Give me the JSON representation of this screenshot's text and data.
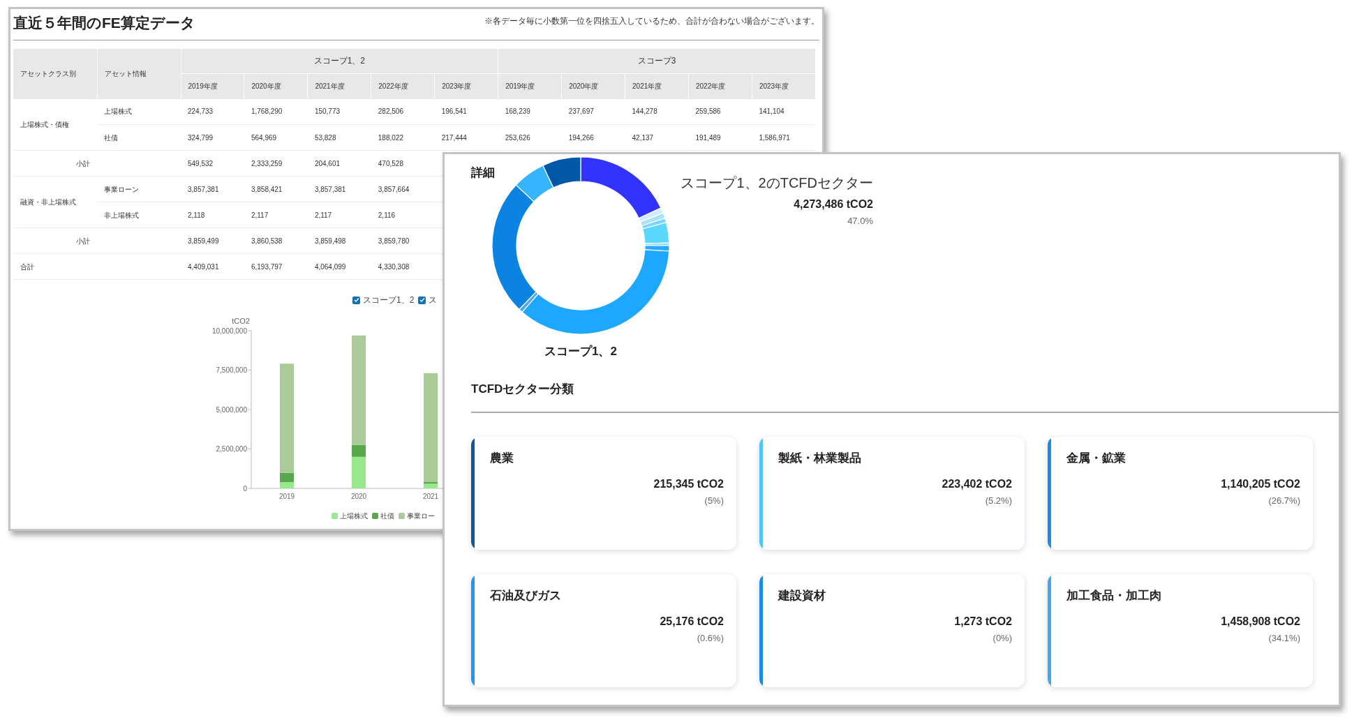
{
  "back_window": {
    "title": "直近５年間のFE算定データ",
    "note": "※各データ毎に小数第一位を四捨五入しているため、合計が合わない場合がございます。",
    "table": {
      "columns": [
        "アセットクラス別",
        "アセット情報"
      ],
      "groups": [
        {
          "label": "スコープ1、2"
        },
        {
          "label": "スコープ3"
        }
      ],
      "years": [
        "2019年度",
        "2020年度",
        "2021年度",
        "2022年度",
        "2023年度",
        "2019年度",
        "2020年度",
        "2021年度",
        "2022年度",
        "2023年度"
      ],
      "sections": [
        {
          "asset_class": "上場株式・債権",
          "rows": [
            {
              "asset": "上場株式",
              "values": [
                "224,733",
                "1,768,290",
                "150,773",
                "282,506",
                "196,541",
                "168,239",
                "237,697",
                "144,278",
                "259,586",
                "141,104"
              ]
            },
            {
              "asset": "社債",
              "values": [
                "324,799",
                "564,969",
                "53,828",
                "188,022",
                "217,444",
                "253,626",
                "194,266",
                "42,137",
                "191,489",
                "1,586,971"
              ]
            }
          ],
          "subtotal": {
            "label": "小計",
            "values": [
              "549,532",
              "2,333,259",
              "204,601",
              "470,528"
            ]
          }
        },
        {
          "asset_class": "融資・非上場株式",
          "rows": [
            {
              "asset": "事業ローン",
              "values": [
                "3,857,381",
                "3,858,421",
                "3,857,381",
                "3,857,664"
              ]
            },
            {
              "asset": "非上場株式",
              "values": [
                "2,118",
                "2,117",
                "2,117",
                "2,116"
              ]
            }
          ],
          "subtotal": {
            "label": "小計",
            "values": [
              "3,859,499",
              "3,860,538",
              "3,859,498",
              "3,859,780"
            ]
          }
        }
      ],
      "total": {
        "label": "合計",
        "values": [
          "4,409,031",
          "6,193,797",
          "4,064,099",
          "4,330,308"
        ]
      }
    },
    "scope_toggles": [
      {
        "label": "スコープ1、2",
        "checked": true
      },
      {
        "label": "ス",
        "checked": true
      }
    ],
    "chart_data": {
      "type": "bar",
      "ylabel": "tCO2",
      "categories": [
        "2019",
        "2020",
        "2021"
      ],
      "stacked": true,
      "ylim": [
        0,
        10000000
      ],
      "yticks": [
        {
          "value": 0,
          "label": "0"
        },
        {
          "value": 2500000,
          "label": "2,500,000"
        },
        {
          "value": 5000000,
          "label": "5,000,000"
        },
        {
          "value": 7500000,
          "label": "7,500,000"
        },
        {
          "value": 10000000,
          "label": "10,000,000"
        }
      ],
      "series": [
        {
          "name": "上場株式",
          "color": "#98e88e",
          "values": [
            400000,
            2000000,
            300000
          ]
        },
        {
          "name": "社債",
          "color": "#57a84a",
          "values": [
            580000,
            760000,
            100000
          ]
        },
        {
          "name": "事業ロー",
          "color": "#a8cb98",
          "values": [
            6930000,
            6940000,
            6910000
          ]
        }
      ]
    }
  },
  "front_window": {
    "heading": "詳細",
    "donut_caption": "スコープ1、2",
    "summary": {
      "title": "スコープ1、2のTCFDセクター",
      "value": "4,273,486 tCO2",
      "share": "47.0%"
    },
    "section_title": "TCFDセクター分類",
    "cards": [
      {
        "title": "農業",
        "value": "215,345 tCO2",
        "share": "(5%)",
        "color": "#0b5aa0"
      },
      {
        "title": "製紙・林業製品",
        "value": "223,402 tCO2",
        "share": "(5.2%)",
        "color": "#4fc3f7"
      },
      {
        "title": "金属・鉱業",
        "value": "1,140,205 tCO2",
        "share": "(26.7%)",
        "color": "#1e88e5"
      },
      {
        "title": "石油及びガス",
        "value": "25,176 tCO2",
        "share": "(0.6%)",
        "color": "#2196f3"
      },
      {
        "title": "建設資材",
        "value": "1,273 tCO2",
        "share": "(0%)",
        "color": "#1a8ae8"
      },
      {
        "title": "加工食品・加工肉",
        "value": "1,458,908 tCO2",
        "share": "(34.1%)",
        "color": "#42a5f5"
      }
    ]
  }
}
